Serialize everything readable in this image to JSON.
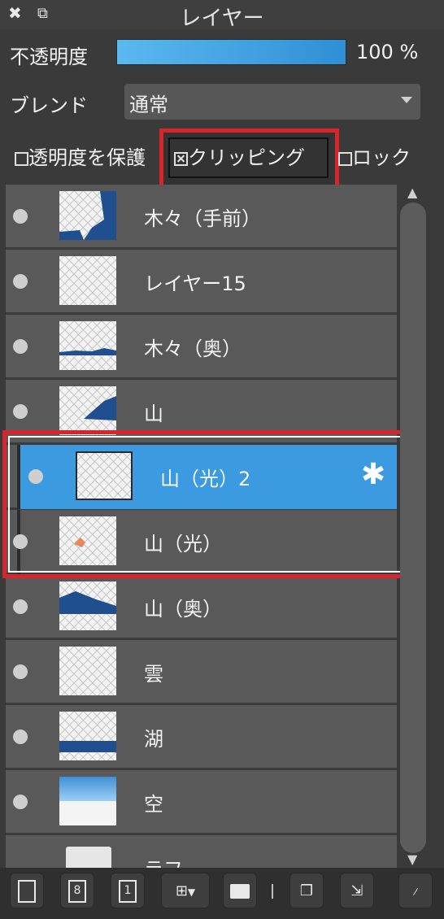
{
  "panel": {
    "title": "レイヤー",
    "close_icon": "close-icon",
    "popout_icon": "popout-icon"
  },
  "opacity": {
    "label": "不透明度",
    "value_text": "100 %",
    "value": 1.0
  },
  "blend": {
    "label": "ブレンド",
    "selected": "通常"
  },
  "options": {
    "preserve_alpha": "透明度を保護",
    "clipping": "クリッピング",
    "lock": "ロック",
    "clipping_checked": true
  },
  "layers": [
    {
      "name": "木々（手前）",
      "selected": false,
      "clipped": false
    },
    {
      "name": "レイヤー15",
      "selected": false,
      "clipped": false
    },
    {
      "name": "木々（奥）",
      "selected": false,
      "clipped": false
    },
    {
      "name": "山",
      "selected": false,
      "clipped": false
    },
    {
      "name": "山（光）2",
      "selected": true,
      "clipped": true
    },
    {
      "name": "山（光）",
      "selected": false,
      "clipped": true
    },
    {
      "name": "山（奥）",
      "selected": false,
      "clipped": false
    },
    {
      "name": "雲",
      "selected": false,
      "clipped": false
    },
    {
      "name": "湖",
      "selected": false,
      "clipped": false
    },
    {
      "name": "空",
      "selected": false,
      "clipped": false
    },
    {
      "name": "ラフ",
      "selected": false,
      "clipped": false,
      "folder": true
    }
  ],
  "toolbar": {
    "btn_new8": "8",
    "btn_new1": "1"
  },
  "colors": {
    "accent": "#3c9be0",
    "highlight": "#d8252b"
  }
}
